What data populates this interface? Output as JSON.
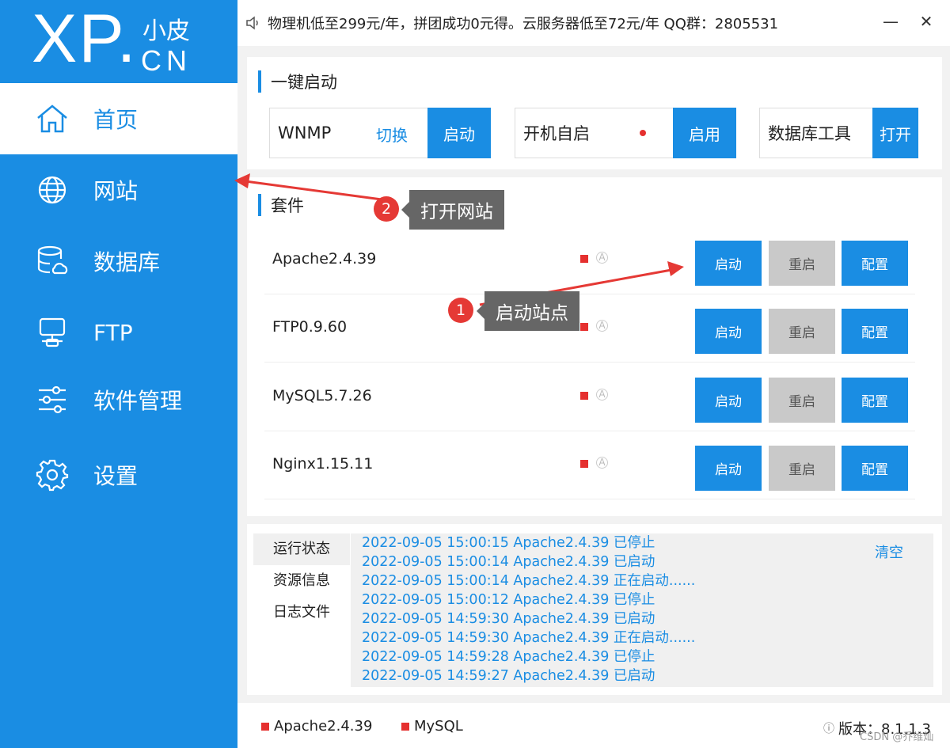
{
  "sidebar": {
    "logo_main": "XP.",
    "logo_small": "小皮",
    "logo_cn": "CN",
    "items": [
      {
        "label": "首页",
        "icon": "home-icon"
      },
      {
        "label": "网站",
        "icon": "globe-icon"
      },
      {
        "label": "数据库",
        "icon": "database-icon"
      },
      {
        "label": "FTP",
        "icon": "server-icon"
      },
      {
        "label": "软件管理",
        "icon": "sliders-icon"
      },
      {
        "label": "设置",
        "icon": "gear-icon"
      }
    ]
  },
  "topbar": {
    "notice": "物理机低至299元/年，拼团成功0元得。云服务器低至72元/年 QQ群：2805531",
    "minimize": "—",
    "close": "✕"
  },
  "quick_start": {
    "title": "一键启动",
    "wnmp_label": "WNMP",
    "switch_label": "切换",
    "start_label": "启动",
    "autostart_label": "开机自启",
    "enable_label": "启用",
    "db_tool_label": "数据库工具",
    "open_label": "打开"
  },
  "suite": {
    "title": "套件",
    "rows": [
      {
        "name": "Apache2.4.39",
        "start": "启动",
        "restart": "重启",
        "config": "配置"
      },
      {
        "name": "FTP0.9.60",
        "start": "启动",
        "restart": "重启",
        "config": "配置"
      },
      {
        "name": "MySQL5.7.26",
        "start": "启动",
        "restart": "重启",
        "config": "配置"
      },
      {
        "name": "Nginx1.15.11",
        "start": "启动",
        "restart": "重启",
        "config": "配置"
      }
    ],
    "auto_symbol": "A"
  },
  "log": {
    "tabs": [
      "运行状态",
      "资源信息",
      "日志文件"
    ],
    "clear_label": "清空",
    "lines": [
      "2022-09-05 15:00:15 Apache2.4.39 已停止",
      "2022-09-05 15:00:14 Apache2.4.39 已启动",
      "2022-09-05 15:00:14 Apache2.4.39 正在启动......",
      "2022-09-05 15:00:12 Apache2.4.39 已停止",
      "2022-09-05 14:59:30 Apache2.4.39 已启动",
      "2022-09-05 14:59:30 Apache2.4.39 正在启动......",
      "2022-09-05 14:59:28 Apache2.4.39 已停止",
      "2022-09-05 14:59:27 Apache2.4.39 已启动"
    ]
  },
  "statusbar": {
    "apache": "Apache2.4.39",
    "mysql": "MySQL",
    "version": "版本：8.1.1.3",
    "info_icon": "ⓘ"
  },
  "annotations": {
    "tip1_number": "1",
    "tip1_text": "启动站点",
    "tip2_number": "2",
    "tip2_text": "打开网站"
  },
  "watermark": "CSDN @乔维灿",
  "colors": {
    "accent": "#1a8de3",
    "stopped": "#e5302f",
    "annotation": "#e53935"
  }
}
